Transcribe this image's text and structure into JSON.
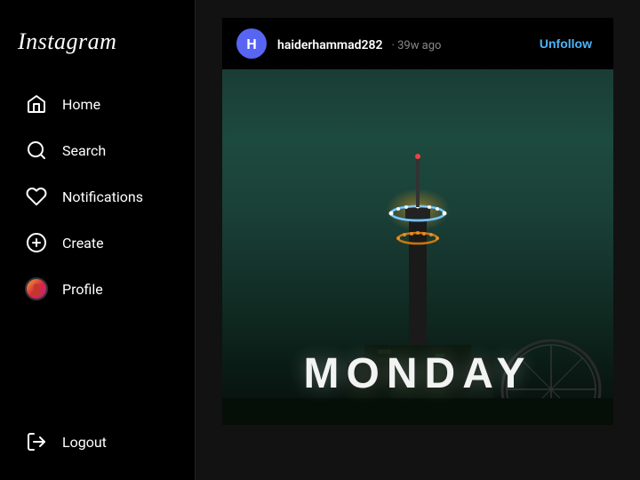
{
  "app": {
    "title": "Instagram"
  },
  "sidebar": {
    "nav_items": [
      {
        "id": "home",
        "label": "Home",
        "icon": "home-icon"
      },
      {
        "id": "search",
        "label": "Search",
        "icon": "search-icon"
      },
      {
        "id": "notifications",
        "label": "Notifications",
        "icon": "heart-icon"
      },
      {
        "id": "create",
        "label": "Create",
        "icon": "plus-circle-icon"
      },
      {
        "id": "profile",
        "label": "Profile",
        "icon": "profile-avatar-icon"
      }
    ],
    "logout_label": "Logout"
  },
  "post": {
    "username": "haiderhammad282",
    "time": "39w ago",
    "unfollow_label": "Unfollow",
    "avatar_letter": "H",
    "image_text": "MONDAY"
  }
}
